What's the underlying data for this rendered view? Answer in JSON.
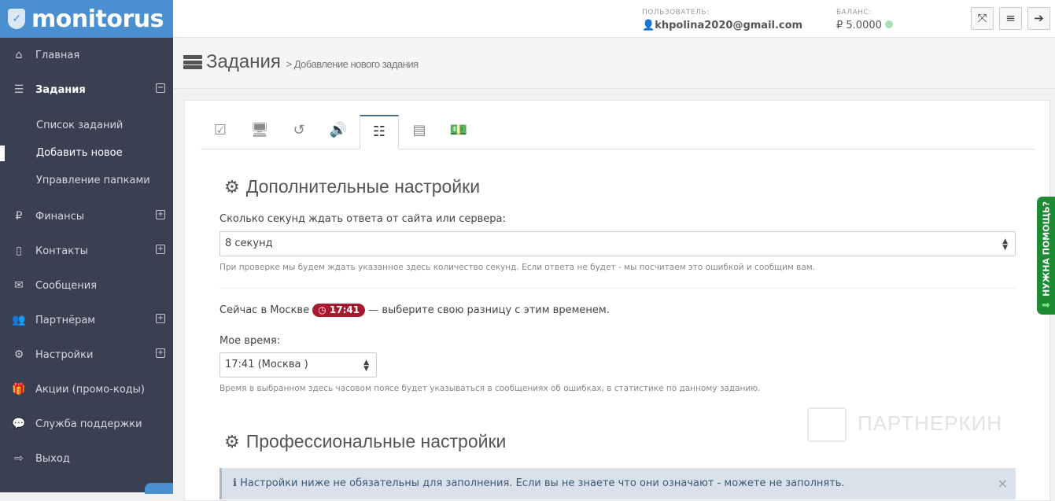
{
  "logo": "monitorus",
  "sidebar": {
    "items": [
      {
        "label": "Главная",
        "icon": "home-icon"
      },
      {
        "label": "Задания",
        "icon": "tasks-icon"
      },
      {
        "label": "Финансы",
        "icon": "ruble-icon"
      },
      {
        "label": "Контакты",
        "icon": "mobile-icon"
      },
      {
        "label": "Сообщения",
        "icon": "envelope-icon"
      },
      {
        "label": "Партнёрам",
        "icon": "users-icon"
      },
      {
        "label": "Настройки",
        "icon": "gear-icon"
      },
      {
        "label": "Акции (промо-коды)",
        "icon": "gift-icon"
      },
      {
        "label": "Служба поддержки",
        "icon": "comments-icon"
      },
      {
        "label": "Выход",
        "icon": "logout-icon"
      }
    ],
    "submenu": [
      "Список заданий",
      "Добавить новое",
      "Управление папками"
    ]
  },
  "header": {
    "user_label": "ПОЛЬЗОВАТЕЛЬ:",
    "user": "khpolina2020@gmail.com",
    "balance_label": "БАЛАНС:",
    "balance": "₽ 5.0000"
  },
  "page": {
    "title": "Задания",
    "crumb": "> Добавление нового задания"
  },
  "section1": {
    "title": "Дополнительные настройки",
    "timeout_label": "Сколько секунд ждать ответа от сайта или сервера:",
    "timeout_value": "8 секунд",
    "timeout_hint": "При проверке мы будем ждать указанное здесь количество секунд. Если ответа не будет - мы посчитаем это ошибкой и сообщим вам.",
    "moscow_prefix": "Сейчас в Москве",
    "moscow_time": "17:41",
    "moscow_suffix": "— выберите свою разницу с этим временем.",
    "mytime_label": "Мое время:",
    "mytime_value": "17:41 (Москва )",
    "mytime_hint": "Время в выбранном здесь часовом поясе будет указываться в сообщениях об ошибках, в статистике по данному заданию."
  },
  "section2": {
    "title": "Профессиональные настройки",
    "alert": "Настройки ниже не обязательны для заполнения. Если вы не знаете что они означают - можете не заполнять."
  },
  "help_tab": "НУЖНА ПОМОЩЬ?",
  "watermark": "ПАРТНЕРКИН"
}
